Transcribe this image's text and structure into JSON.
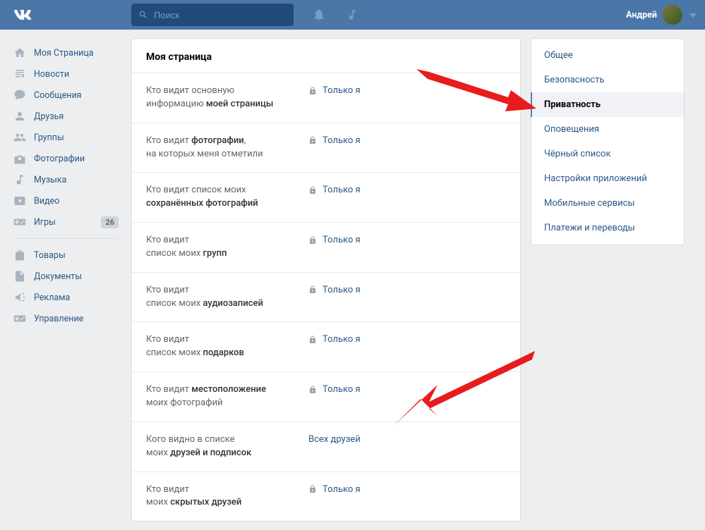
{
  "header": {
    "search_placeholder": "Поиск",
    "username": "Андрей"
  },
  "sidebar": {
    "items": [
      {
        "label": "Моя Страница",
        "icon": "home"
      },
      {
        "label": "Новости",
        "icon": "news"
      },
      {
        "label": "Сообщения",
        "icon": "messages"
      },
      {
        "label": "Друзья",
        "icon": "friends"
      },
      {
        "label": "Группы",
        "icon": "groups"
      },
      {
        "label": "Фотографии",
        "icon": "photos"
      },
      {
        "label": "Музыка",
        "icon": "music"
      },
      {
        "label": "Видео",
        "icon": "video"
      },
      {
        "label": "Игры",
        "icon": "games",
        "badge": "26"
      }
    ],
    "items2": [
      {
        "label": "Товары",
        "icon": "market"
      },
      {
        "label": "Документы",
        "icon": "docs"
      },
      {
        "label": "Реклама",
        "icon": "ads"
      },
      {
        "label": "Управление",
        "icon": "manage"
      }
    ]
  },
  "content": {
    "title": "Моя страница",
    "rows": [
      {
        "prefix": "Кто видит основную",
        "suffix_text": "информацию ",
        "bold": "моей страницы",
        "value": "Только я",
        "locked": true
      },
      {
        "prefix": "Кто видит ",
        "bold_mid": "фотографии",
        "comma": ",",
        "suffix_text": "на которых меня отметили",
        "value": "Только я",
        "locked": true
      },
      {
        "prefix": "Кто видит список моих",
        "bold_below": "сохранённых фотографий",
        "value": "Только я",
        "locked": true
      },
      {
        "prefix": "Кто видит",
        "suffix_text": "список моих ",
        "bold": "групп",
        "value": "Только я",
        "locked": true
      },
      {
        "prefix": "Кто видит",
        "suffix_text": "список моих ",
        "bold": "аудиозаписей",
        "value": "Только я",
        "locked": true
      },
      {
        "prefix": "Кто видит",
        "suffix_text": "список моих ",
        "bold": "подарков",
        "value": "Только я",
        "locked": true
      },
      {
        "prefix": "Кто видит ",
        "bold_mid": "местоположение",
        "suffix_text": "моих фотографий",
        "value": "Только я",
        "locked": true
      },
      {
        "prefix": "Кого видно в списке",
        "suffix_text": "моих ",
        "bold": "друзей и подписок",
        "value": "Всех друзей",
        "locked": false
      },
      {
        "prefix": "Кто видит",
        "suffix_text": "моих ",
        "bold": "скрытых друзей",
        "value": "Только я",
        "locked": true
      }
    ]
  },
  "settings_nav": {
    "items": [
      {
        "label": "Общее"
      },
      {
        "label": "Безопасность"
      },
      {
        "label": "Приватность",
        "active": true
      },
      {
        "label": "Оповещения"
      },
      {
        "label": "Чёрный список"
      },
      {
        "label": "Настройки приложений"
      },
      {
        "label": "Мобильные сервисы"
      },
      {
        "label": "Платежи и переводы"
      }
    ]
  }
}
